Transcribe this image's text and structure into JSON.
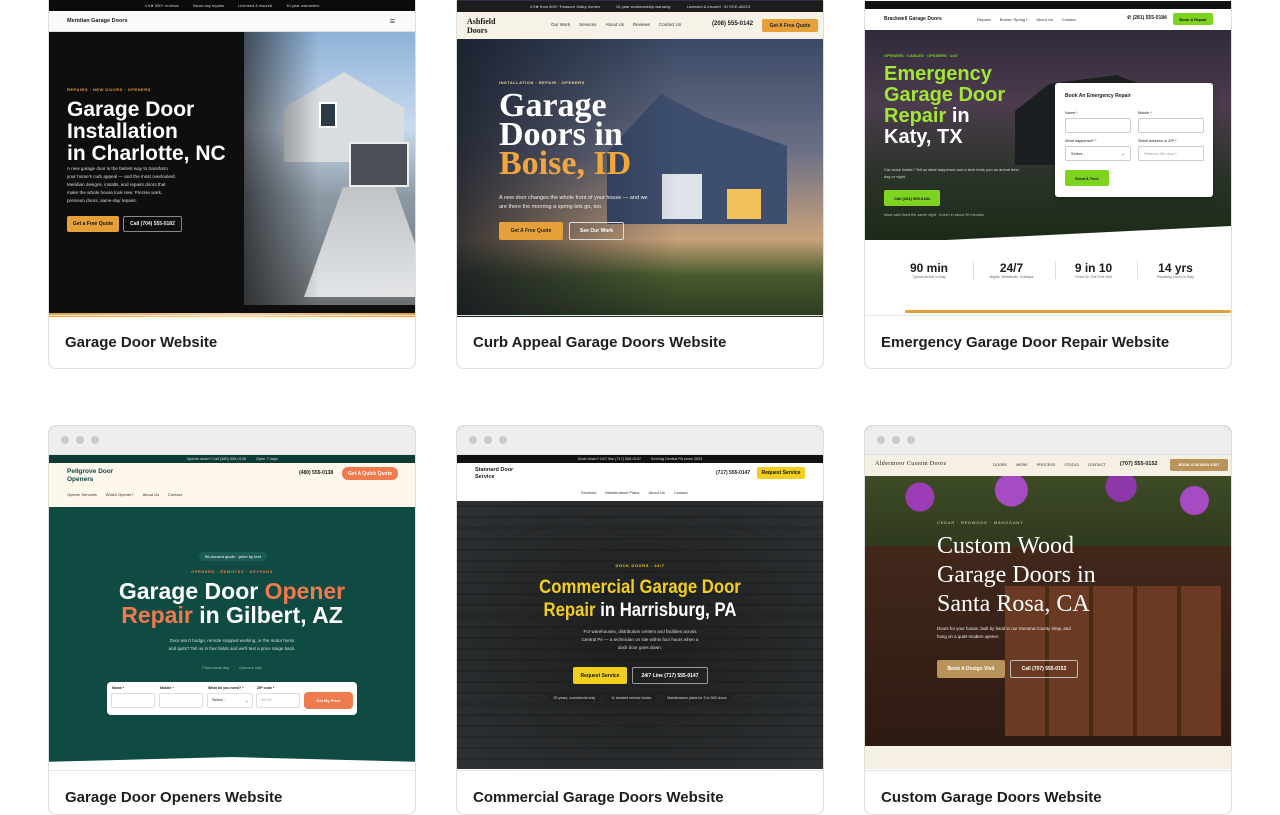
{
  "cards": [
    {
      "title": "Garage Door Website",
      "brand": "Meridian Garage Doors",
      "top_badges": [
        "4.9★ 550+ reviews",
        "Same-day repairs",
        "Licensed & insured",
        "10-year warranties"
      ],
      "eyebrow": "REPAIRS · NEW DOORS · OPENERS",
      "headline": [
        "Garage Door",
        "Installation",
        "in Charlotte, NC"
      ],
      "body": [
        "A new garage door is the fastest way to transform",
        "your home's curb appeal — and the most overlooked.",
        "Meridian designs, installs, and repairs doors that",
        "make the whole house look new. Precise work,",
        "premium doors, same-day repairs."
      ],
      "cta_primary": "Get a Free Quote",
      "cta_secondary": "Call (704) 555-0182"
    },
    {
      "title": "Curb Appeal Garage Doors Website",
      "brand": [
        "Ashfield",
        "Doors"
      ],
      "top_badges": [
        "4.9★ from 600+ Treasure Valley homes",
        "10-year workmanship warranty",
        "Licensed & insured · ID RCE-48213"
      ],
      "nav": [
        "Our Work",
        "Services",
        "About Us",
        "Reviews",
        "Contact Us"
      ],
      "phone": "(208) 555-0142",
      "nav_cta": "Get A Free Quote",
      "eyebrow": "INSTALLATION · REPAIR · OPENERS",
      "headline": [
        "Garage",
        "Doors in",
        "Boise, ID"
      ],
      "body": [
        "A new door changes the whole front of your house — and we",
        "are there the morning a spring lets go, too."
      ],
      "cta_primary": "Get A Free Quote",
      "cta_secondary": "See Our Work"
    },
    {
      "title": "Emergency Garage Door Repair Website",
      "topbar": "Door stuck? Call (281) 555-0184 · Repairs 7 days a week",
      "brand": "Brackwell Garage Doors",
      "nav": [
        "Repairs",
        "Broken Spring?",
        "About Us",
        "Contact"
      ],
      "phone": "(281) 555-0184",
      "nav_cta": "Book A Repair",
      "eyebrow": "OPENERS · CABLES · OPENERS · 24/7",
      "headline": [
        "Emergency",
        "Garage Door",
        "Repair",
        "in",
        "Katy, TX"
      ],
      "body": [
        "Car stuck inside? Tell us what happened and a tech texts you an arrival time,",
        "day or night."
      ],
      "cta_primary": "Call (281) 555-0184",
      "footnote": "Most calls fixed the same night · A tech in about 90 minutes",
      "form": {
        "title": "Book An Emergency Repair",
        "name_label": "Name *",
        "mobile_label": "Mobile *",
        "what_label": "What happened? *",
        "what_value": "Select...",
        "address_label": "Street address or ZIP *",
        "address_placeholder": "Where's the door?",
        "submit": "Send A Tech"
      },
      "stats": [
        {
          "value": "90 min",
          "label": "Typical Arrival in Katy"
        },
        {
          "value": "24/7",
          "label": "Nights, Weekends, Holidays"
        },
        {
          "value": "9 in 10",
          "label": "Fixed On The First Visit"
        },
        {
          "value": "14 yrs",
          "label": "Repairing Doors in Katy"
        }
      ]
    },
    {
      "title": "Garage Door Openers Website",
      "topbar": [
        "Opener down? Call (480) 555-0138",
        "Open 7 days"
      ],
      "brand": [
        "Pellgrove Door",
        "Openers"
      ],
      "phone": "(480) 555-0138",
      "nav_cta": "Get A Quick Quote",
      "nav": [
        "Opener Services",
        "Which Opener?",
        "About Us",
        "Contact"
      ],
      "pill": "60-second quote · price by text",
      "eyebrow": "OPENERS · REMOTES · KEYPADS",
      "headline_a": "Garage Door ",
      "headline_b": "Opener",
      "headline_c": "Repair",
      "headline_d": " in Gilbert, AZ",
      "body": [
        "Door won't budge, remote stopped working, or the motor hums",
        "and quits? Tell us in four fields and we'll text a price range back."
      ],
      "meta": [
        "Fixed same day",
        "Openers only"
      ],
      "form": {
        "name_label": "Name *",
        "mobile_label": "Mobile *",
        "what_label": "What do you need? *",
        "what_value": "Select...",
        "zip_label": "ZIP code *",
        "zip_placeholder": "85234",
        "submit": "Get My Price"
      }
    },
    {
      "title": "Commercial Garage Doors Website",
      "topbar": [
        "Dock down? 24/7 line (717) 555-0147",
        "Serving Central PA since 2003"
      ],
      "brand": [
        "Stannard Door",
        "Service"
      ],
      "phone": "(717) 555-0147",
      "nav_cta": "Request Service",
      "nav": [
        "Services",
        "Maintenance Plans",
        "About Us",
        "Contact"
      ],
      "eyebrow": "DOCK DOORS · 24/7",
      "headline_a": "Commercial Garage Door",
      "headline_b": "Repair",
      "headline_c": " in Harrisburg, PA",
      "body": [
        "For warehouses, distribution centers and facilities across",
        "Central PA — a technician on site within four hours when a",
        "dock door goes down."
      ],
      "cta_primary": "Request Service",
      "cta_secondary": "24/7 Line (717) 555-0147",
      "badges": [
        "25 years, commercial only",
        "11 stocked service trucks",
        "Maintenance plans for 5 to 300 doors"
      ]
    },
    {
      "title": "Custom Garage Doors Website",
      "brand": "Aldermoor Custom Doors",
      "nav": [
        "DOORS",
        "WORK",
        "PROCESS",
        "STUDIO",
        "CONTACT"
      ],
      "phone": "(707) 555-0152",
      "nav_cta": "BOOK A DESIGN VISIT",
      "eyebrow": "CEDAR · REDWOOD · MAHOGANY",
      "headline": [
        "Custom Wood",
        "Garage Doors in",
        "Santa Rosa, CA"
      ],
      "body": [
        "Doors for your house, built by hand in our Sonoma County shop, and",
        "hung on a quiet modern opener."
      ],
      "cta_primary": "Book A Design Visit",
      "cta_secondary": "Call (707) 555-0152"
    }
  ],
  "colors": {
    "orange": "#e6a03a",
    "green_cta": "#7ed321",
    "teal": "#0f4a43",
    "coral": "#ef7a4d",
    "yellow": "#f2cf1e",
    "brown": "#b8945a"
  }
}
